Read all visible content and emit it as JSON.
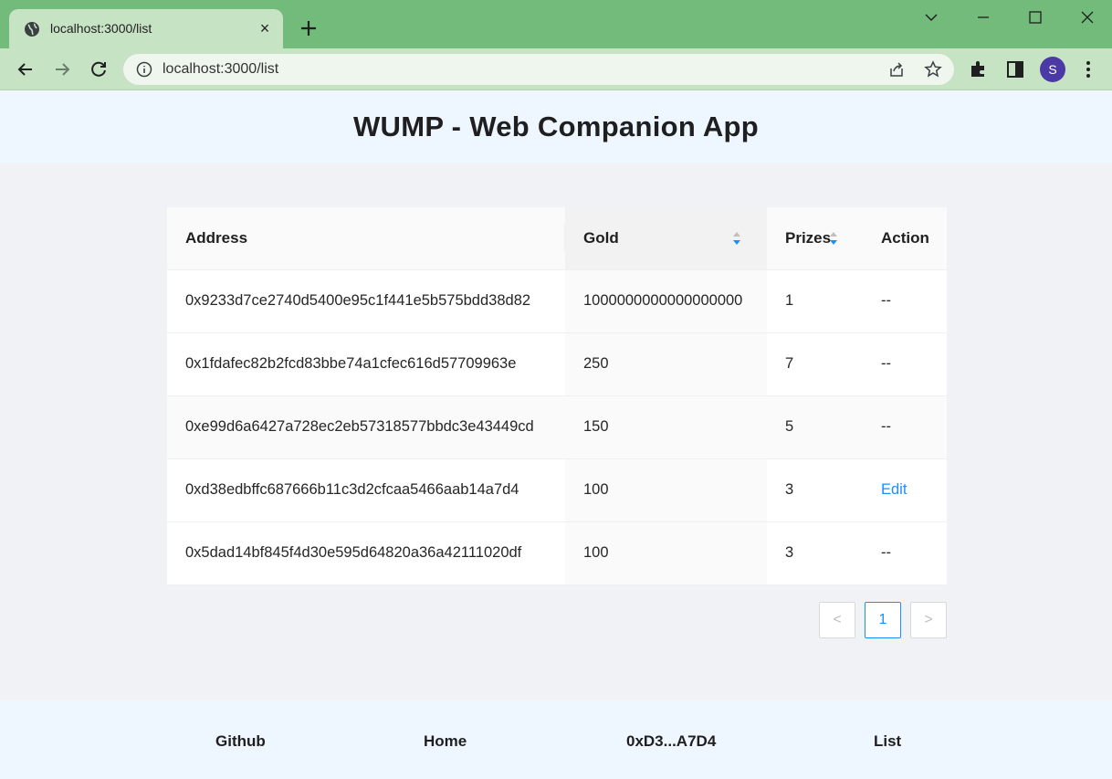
{
  "browser": {
    "tab_title": "localhost:3000/list",
    "tab_close": "×",
    "address": "localhost:3000/list",
    "profile_initial": "S",
    "icons": [
      "globe-icon",
      "close-icon",
      "plus-icon",
      "chevron-down-icon",
      "minimize-icon",
      "maximize-icon",
      "close-window-icon",
      "back-icon",
      "forward-icon",
      "reload-icon",
      "info-icon",
      "share-icon",
      "star-icon",
      "extensions-icon",
      "side-panel-icon",
      "more-icon"
    ]
  },
  "app": {
    "title": "WUMP - Web Companion App"
  },
  "table": {
    "headers": {
      "address": "Address",
      "gold": "Gold",
      "prizes": "Prizes",
      "action": "Action"
    },
    "rows": [
      {
        "address": "0x9233d7ce2740d5400e95c1f441e5b575bdd38d82",
        "gold": "1000000000000000000",
        "prizes": "1",
        "action": "--"
      },
      {
        "address": "0x1fdafec82b2fcd83bbe74a1cfec616d57709963e",
        "gold": "250",
        "prizes": "7",
        "action": "--"
      },
      {
        "address": "0xe99d6a6427a728ec2eb57318577bbdc3e43449cd",
        "gold": "150",
        "prizes": "5",
        "action": "--"
      },
      {
        "address": "0xd38edbffc687666b11c3d2cfcaa5466aab14a7d4",
        "gold": "100",
        "prizes": "3",
        "action": "Edit"
      },
      {
        "address": "0x5dad14bf845f4d30e595d64820a36a42111020df",
        "gold": "100",
        "prizes": "3",
        "action": "--"
      }
    ]
  },
  "pagination": {
    "prev": "<",
    "current": "1",
    "next": ">"
  },
  "footer": {
    "github": "Github",
    "home": "Home",
    "account": "0xD3...A7D4",
    "list": "List"
  },
  "colors": {
    "tabbar": "#72bb7a",
    "toolbar": "#c6e3c4",
    "accent": "#1890ff",
    "header_bg": "#eef6ff",
    "page_bg": "#f0f2f5"
  }
}
